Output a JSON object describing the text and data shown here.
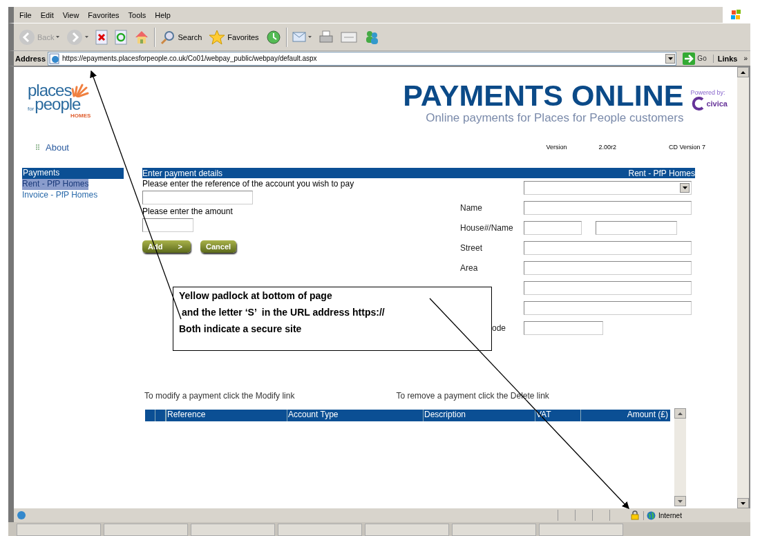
{
  "menu": [
    "File",
    "Edit",
    "View",
    "Favorites",
    "Tools",
    "Help"
  ],
  "toolbar": [
    {
      "kind": "back",
      "label": "Back",
      "disabled": true
    },
    {
      "kind": "forward",
      "disabled": true
    },
    {
      "kind": "stop"
    },
    {
      "kind": "refresh"
    },
    {
      "kind": "home"
    },
    {
      "kind": "search",
      "label": "Search"
    },
    {
      "kind": "favorites",
      "label": "Favorites"
    },
    {
      "kind": "history"
    },
    {
      "kind": "mail"
    },
    {
      "kind": "print"
    },
    {
      "kind": "edit"
    },
    {
      "kind": "messenger"
    }
  ],
  "address_bar": {
    "label": "Address",
    "url": "https://epayments.placesforpeople.co.uk/Co01/webpay_public/webpay/default.aspx",
    "go": "Go",
    "links": "Links",
    "more": "»"
  },
  "logo": {
    "top": "places",
    "small": "for",
    "bottom": "people",
    "sub": "HOMES"
  },
  "banner": {
    "title": "PAYMENTS ONLINE",
    "subtitle": "Online payments for Places for People customers",
    "powered": "Powered by:",
    "brand": "civica"
  },
  "about": "About",
  "version": {
    "label": "Version",
    "number": "2.00r2",
    "cd": "CD Version 7"
  },
  "sidebar": {
    "header": "Payments",
    "items": [
      {
        "label": "Rent - PfP Homes",
        "selected": true
      },
      {
        "label": "Invoice - PfP Homes",
        "selected": false
      }
    ]
  },
  "form": {
    "header": "Enter payment details",
    "header_right": "Rent - PfP Homes",
    "reference_label": "Please enter the reference of the account you wish to pay",
    "amount_label": "Please enter the amount",
    "buttons": [
      {
        "kind": "add",
        "label": "Add",
        "arrow": ">"
      },
      {
        "kind": "cancel",
        "label": "Cancel"
      }
    ],
    "address_fields": [
      {
        "kind": "select"
      },
      {
        "kind": "text",
        "label": "Name"
      },
      {
        "kind": "pair",
        "label": "House#/Name"
      },
      {
        "kind": "text",
        "label": "Street"
      },
      {
        "kind": "text",
        "label": "Area"
      },
      {
        "kind": "text"
      },
      {
        "kind": "text"
      },
      {
        "kind": "short",
        "label": "ode"
      }
    ]
  },
  "hints": {
    "modify": "To modify a payment click the Modify link",
    "delete": "To remove a payment click the Delete link"
  },
  "table": {
    "columns": [
      "Reference",
      "Account Type",
      "Description",
      "VAT",
      "Amount (£)"
    ]
  },
  "status_bar": {
    "zone": "Internet"
  },
  "callout": {
    "lines": [
      "Yellow padlock at bottom of page",
      " and the letter ‘S’  in the URL address https://",
      "Both indicate a secure site"
    ]
  }
}
